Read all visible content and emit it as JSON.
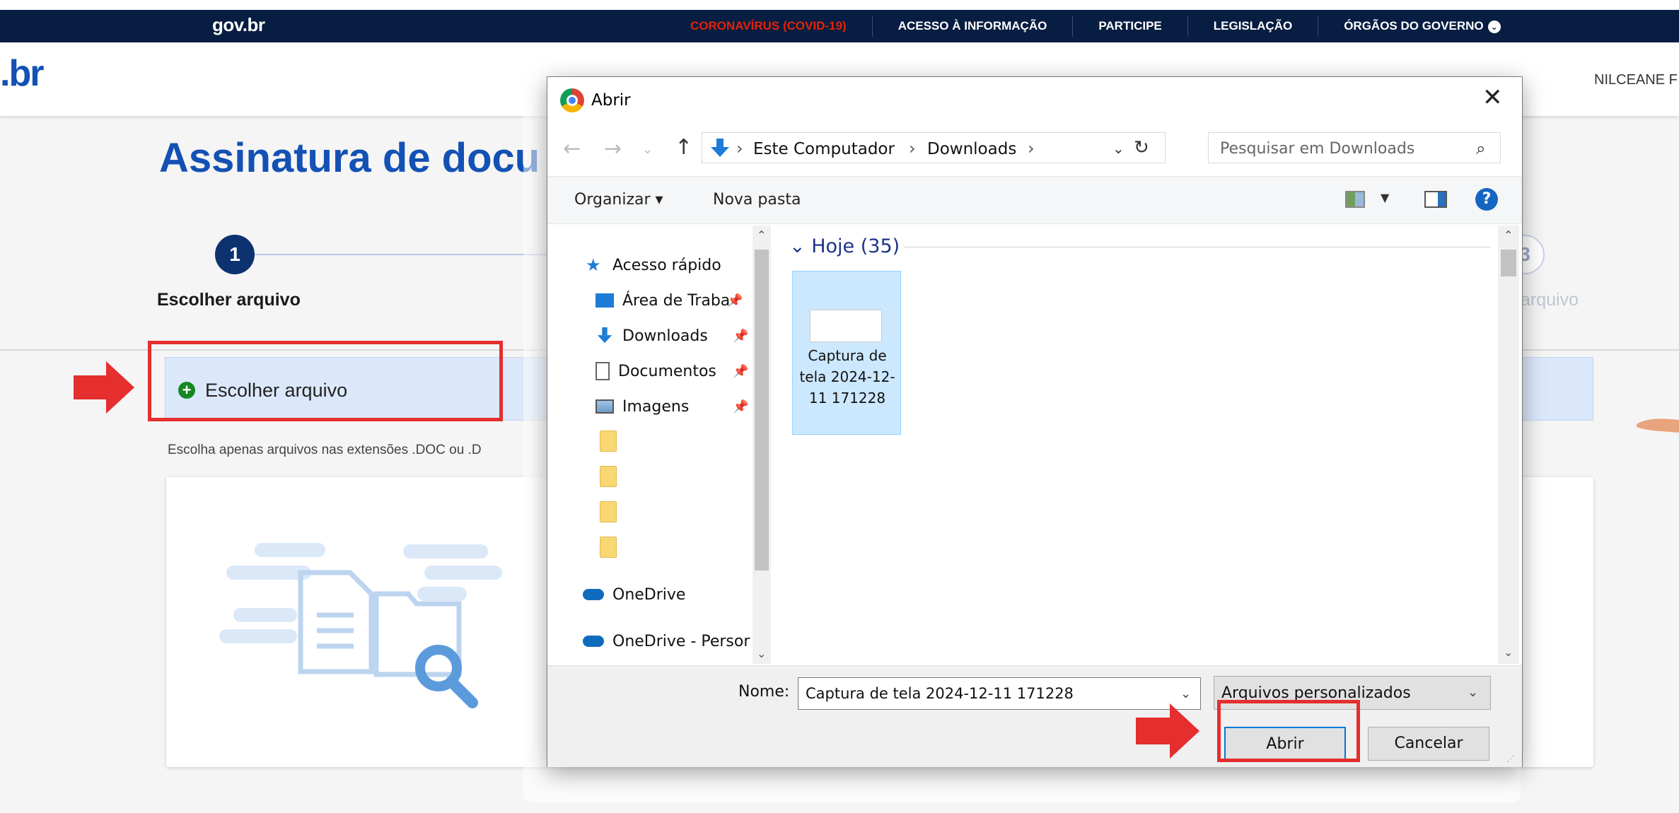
{
  "govbar": {
    "logo": "gov.br",
    "nav": [
      "CORONAVÍRUS (COVID-19)",
      "ACESSO À INFORMAÇÃO",
      "PARTICIPE",
      "LEGISLAÇÃO",
      "ÓRGÃOS DO GOVERNO"
    ],
    "covid_color": "#e52207"
  },
  "header": {
    "logo": ".br",
    "user_name": "NILCEANE F"
  },
  "main": {
    "title": "Assinatura de docu",
    "steps": [
      {
        "number": "1",
        "label": "Escolher arquivo"
      },
      {
        "number": "3",
        "label": "arquivo"
      }
    ],
    "choose_button": "Escolher arquivo",
    "hint": "Escolha apenas arquivos nas extensões .DOC ou .D"
  },
  "dialog": {
    "title": "Abrir",
    "address": [
      "Este Computador",
      "Downloads"
    ],
    "search_placeholder": "Pesquisar em Downloads",
    "toolbar": {
      "organize": "Organizar ▾",
      "new_folder": "Nova pasta"
    },
    "nav_items": [
      {
        "label": "Acesso rápido",
        "icon": "star-icon"
      },
      {
        "label": "Área de Traba",
        "icon": "desktop-icon",
        "pinned": true
      },
      {
        "label": "Downloads",
        "icon": "download-icon",
        "pinned": true
      },
      {
        "label": "Documentos",
        "icon": "document-icon",
        "pinned": true
      },
      {
        "label": "Imagens",
        "icon": "image-icon",
        "pinned": true
      },
      {
        "label": "OneDrive",
        "icon": "cloud-icon"
      },
      {
        "label": "OneDrive - Persor",
        "icon": "cloud-icon"
      }
    ],
    "group": "Hoje (35)",
    "file": {
      "name": "Captura de tela 2024-12-11 171228"
    },
    "name_label": "Nome:",
    "name_value": "Captura de tela 2024-12-11 171228",
    "file_type": "Arquivos personalizados",
    "open_button": "Abrir",
    "cancel_button": "Cancelar"
  },
  "colors": {
    "gov_blue": "#071d41",
    "primary_blue": "#1351b4",
    "highlight_red": "#e52e2e"
  }
}
